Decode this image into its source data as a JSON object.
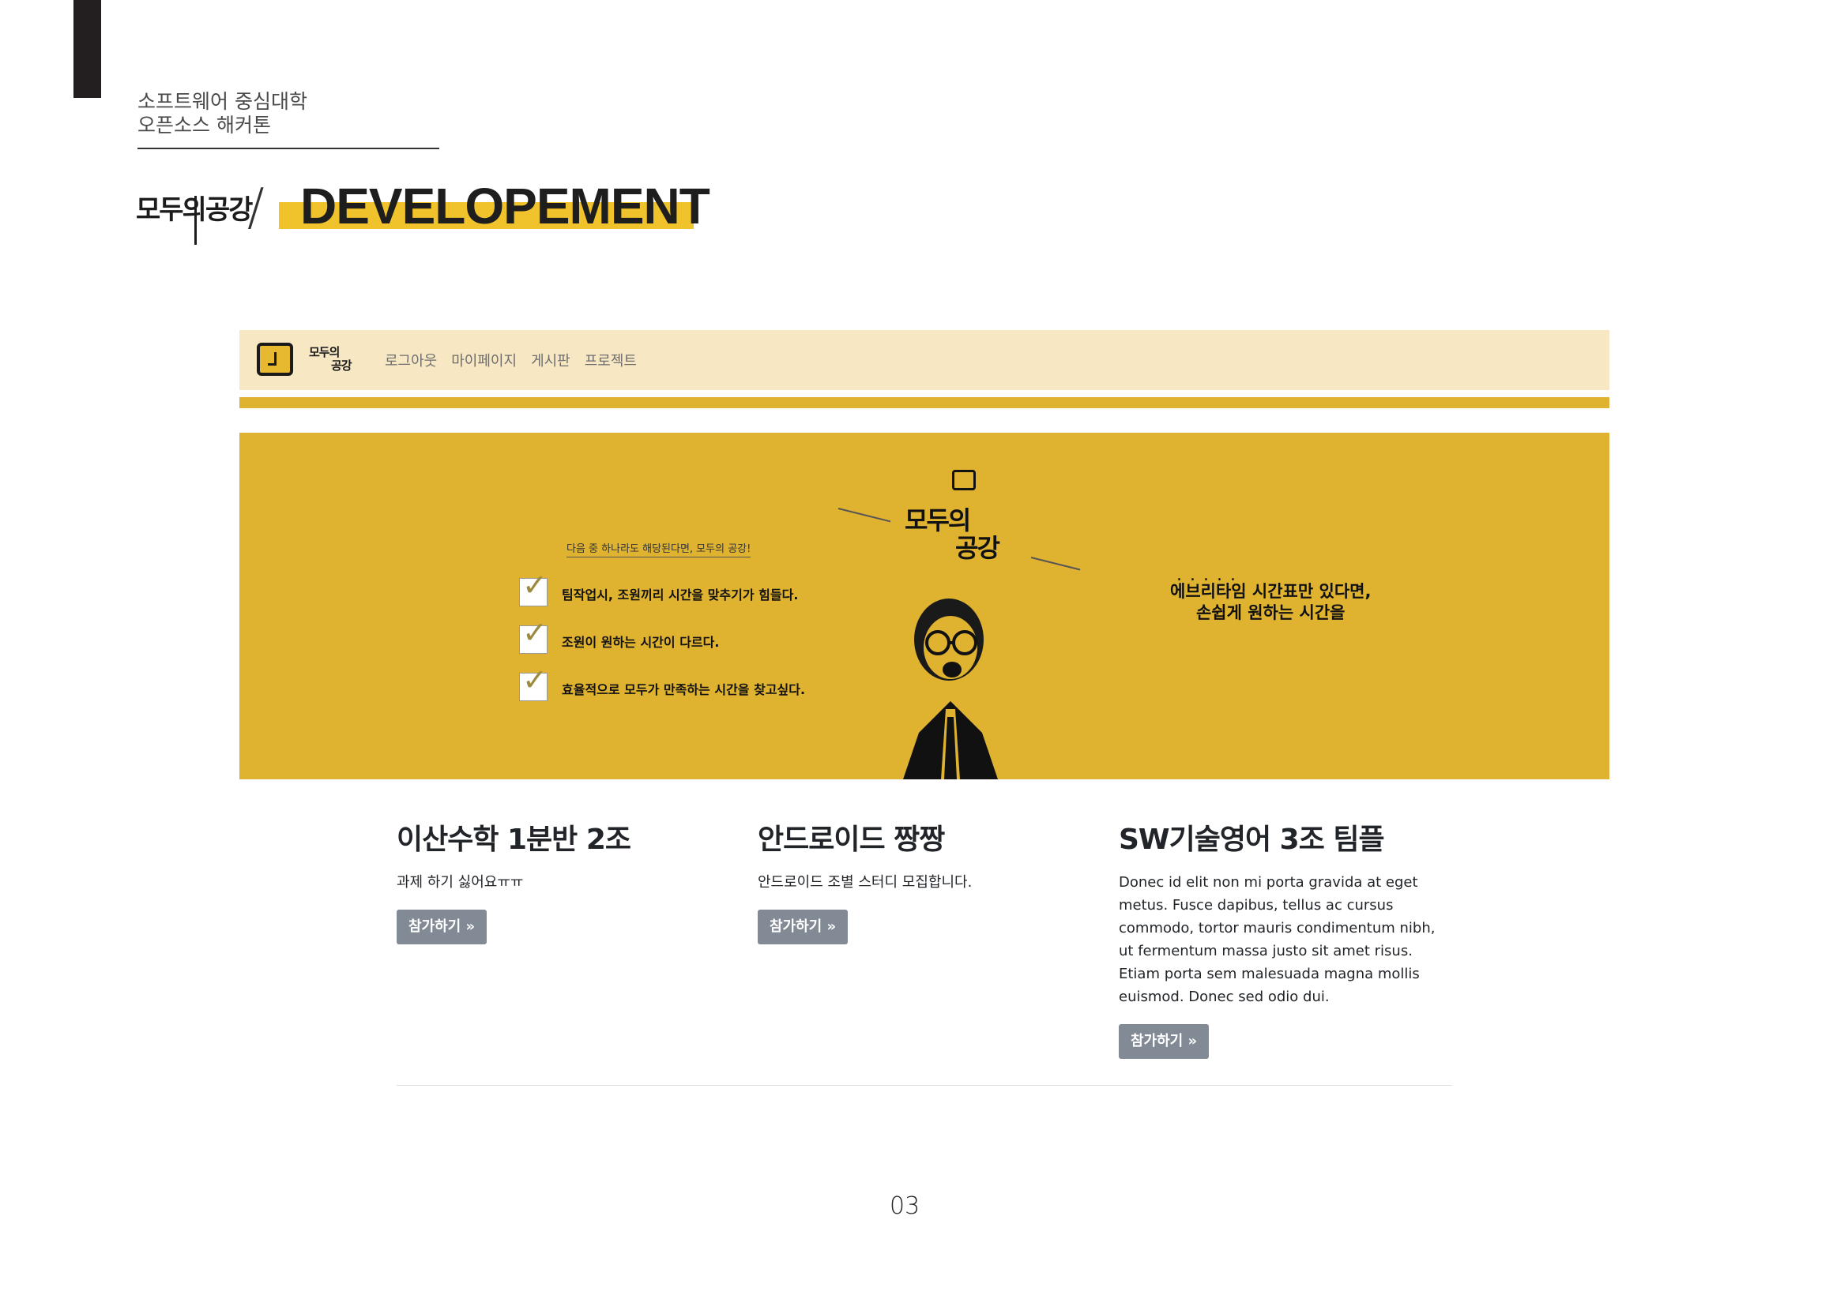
{
  "header": {
    "line1": "소프트웨어 중심대학",
    "line2": "오픈소스 해커톤"
  },
  "title": {
    "logo_text": "모두의공강",
    "slash": "/",
    "heading": "DEVELOPEMENT"
  },
  "screenshot": {
    "nav": {
      "logo_line1": "모두의",
      "logo_line2": "공강",
      "links": [
        "로그아웃",
        "마이페이지",
        "게시판",
        "프로젝트"
      ]
    },
    "banner": {
      "subtitle": "다음 중 하나라도 해당된다면, 모두의 공강!",
      "checks": [
        "팀작업시, 조원끼리 시간을 맞추기가 힘들다.",
        "조원이 원하는 시간이 다르다.",
        "효율적으로 모두가 만족하는 시간을 찾고싶다."
      ],
      "check_mark": "✓",
      "logo_line1": "모두의",
      "logo_line2": "공강",
      "dots": ".....",
      "right_line1": "에브리타임 시간표만 있다면,",
      "right_line2": "손쉽게 원하는 시간을"
    },
    "cards": [
      {
        "title": "이산수학 1분반 2조",
        "text": "과제 하기 싫어요ㅠㅠ",
        "button": "참가하기 »"
      },
      {
        "title": "안드로이드 짱짱",
        "text": "안드로이드 조별 스터디 모집합니다.",
        "button": "참가하기 »"
      },
      {
        "title": "SW기술영어 3조 팀플",
        "text": "Donec id elit non mi porta gravida at eget metus. Fusce dapibus, tellus ac cursus commodo, tortor mauris condimentum nibh, ut fermentum massa justo sit amet risus. Etiam porta sem malesuada magna mollis euismod. Donec sed odio dui.",
        "button": "참가하기 »"
      }
    ]
  },
  "page_number": "03",
  "colors": {
    "accent": "#f0c22b",
    "banner": "#dfb230",
    "nav_bg": "#f7e7c3",
    "button": "#818a95"
  }
}
